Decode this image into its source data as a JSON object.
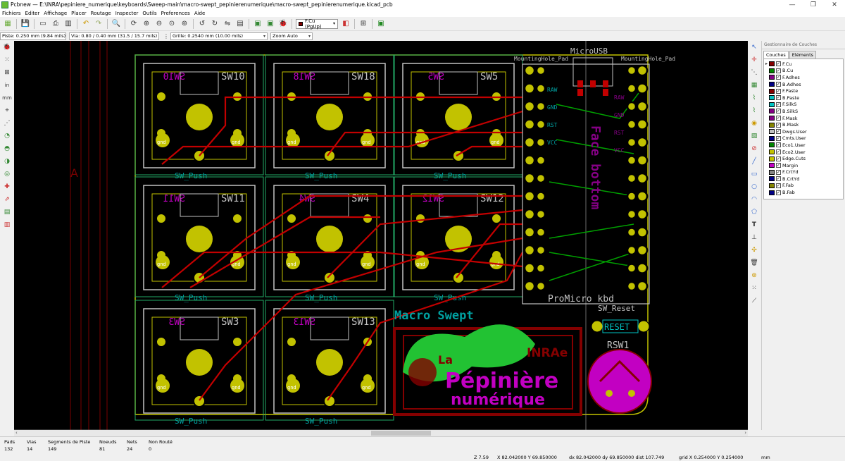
{
  "window": {
    "title": "Pcbnew — E:\\INRA\\pepiniere_numerique\\keyboards\\Sweep-main\\macro-swept_pepinierenumerique\\macro-swept_pepinierenumerique.kicad_pcb",
    "minimize": "—",
    "maximize": "❐",
    "close": "✕"
  },
  "menu": [
    "Fichiers",
    "Editer",
    "Affichage",
    "Placer",
    "Routage",
    "Inspecter",
    "Outils",
    "Preferences",
    "Aide"
  ],
  "toolbar": {
    "layer_select": "F.Cu (PgUp)",
    "layer_color": "#840000"
  },
  "auxbar": {
    "track": "Piste: 0.250 mm (9.84 mils) *",
    "via": "Via: 0.80 / 0.40 mm (31.5 / 15.7 mils) *",
    "grid": "Grille: 0.2540 mm (10.00 mils)",
    "zoom": "Zoom Auto"
  },
  "layers_panel": {
    "title": "Gestionnaire de Couches",
    "tabs": [
      "Couches",
      "Eléments"
    ],
    "layers": [
      {
        "name": "F.Cu",
        "color": "#840000",
        "active": true
      },
      {
        "name": "B.Cu",
        "color": "#008400"
      },
      {
        "name": "F.Adhes",
        "color": "#840084"
      },
      {
        "name": "B.Adhes",
        "color": "#000084"
      },
      {
        "name": "F.Paste",
        "color": "#840000"
      },
      {
        "name": "B.Paste",
        "color": "#00c2c2"
      },
      {
        "name": "F.SilkS",
        "color": "#00c2c2"
      },
      {
        "name": "B.SilkS",
        "color": "#840084"
      },
      {
        "name": "F.Mask",
        "color": "#840084"
      },
      {
        "name": "B.Mask",
        "color": "#848400"
      },
      {
        "name": "Dwgs.User",
        "color": "#c2c2c2"
      },
      {
        "name": "Cmts.User",
        "color": "#000084"
      },
      {
        "name": "Eco1.User",
        "color": "#008400"
      },
      {
        "name": "Eco2.User",
        "color": "#c2c200"
      },
      {
        "name": "Edge.Cuts",
        "color": "#c2c200"
      },
      {
        "name": "Margin",
        "color": "#c200c2"
      },
      {
        "name": "F.CrtYd",
        "color": "#848484"
      },
      {
        "name": "B.CrtYd",
        "color": "#000084"
      },
      {
        "name": "F.Fab",
        "color": "#848400"
      },
      {
        "name": "B.Fab",
        "color": "#000084"
      }
    ]
  },
  "pcb": {
    "switches": [
      {
        "ref": "SW10",
        "mirror": "SW10"
      },
      {
        "ref": "SW18",
        "mirror": "SW18"
      },
      {
        "ref": "SW5",
        "mirror": "SW5"
      },
      {
        "ref": "SW11",
        "mirror": "SW11"
      },
      {
        "ref": "SW4",
        "mirror": "SW4"
      },
      {
        "ref": "SW12",
        "mirror": "SW12"
      },
      {
        "ref": "SW3",
        "mirror": "SW3"
      },
      {
        "ref": "SW13",
        "mirror": "SW13"
      }
    ],
    "sw_value": "SW_Push",
    "gnd": "gnd",
    "mounting_hole": "MountingHole_Pad",
    "micro_usb": "MicroUSB",
    "promicro_label": "ProMicro",
    "promicro_value": "ProMicro_kbd",
    "pins_left": [
      "RAW",
      "GND",
      "RST",
      "VCC"
    ],
    "pins_right": [
      "RAW",
      "GND",
      "RST",
      "VCC"
    ],
    "reset_ref": "SW_Reset",
    "reset_label": "RESET",
    "rsw": "RSW1",
    "macro_text": "Macro Swept",
    "logo_line1": "La",
    "logo_line2": "Pépinière",
    "logo_line3": "numérique",
    "inrae": "INRAe",
    "bottom_silk": "Face bottom",
    "a_marker": "A"
  },
  "status": {
    "pads_k": "Pads",
    "pads_v": "132",
    "vias_k": "Vias",
    "vias_v": "14",
    "seg_k": "Segments de Piste",
    "seg_v": "149",
    "nodes_k": "Noeuds",
    "nodes_v": "81",
    "nets_k": "Nets",
    "nets_v": "24",
    "unrouted_k": "Non Routé",
    "unrouted_v": "0",
    "zoom": "Z 7.59",
    "xy": "X 82.042000  Y 69.850000",
    "dxy": "dx 82.042000  dy 69.850000  dist 107.749",
    "grid": "grid X 0.254000  Y 0.254000",
    "units": "mm"
  }
}
